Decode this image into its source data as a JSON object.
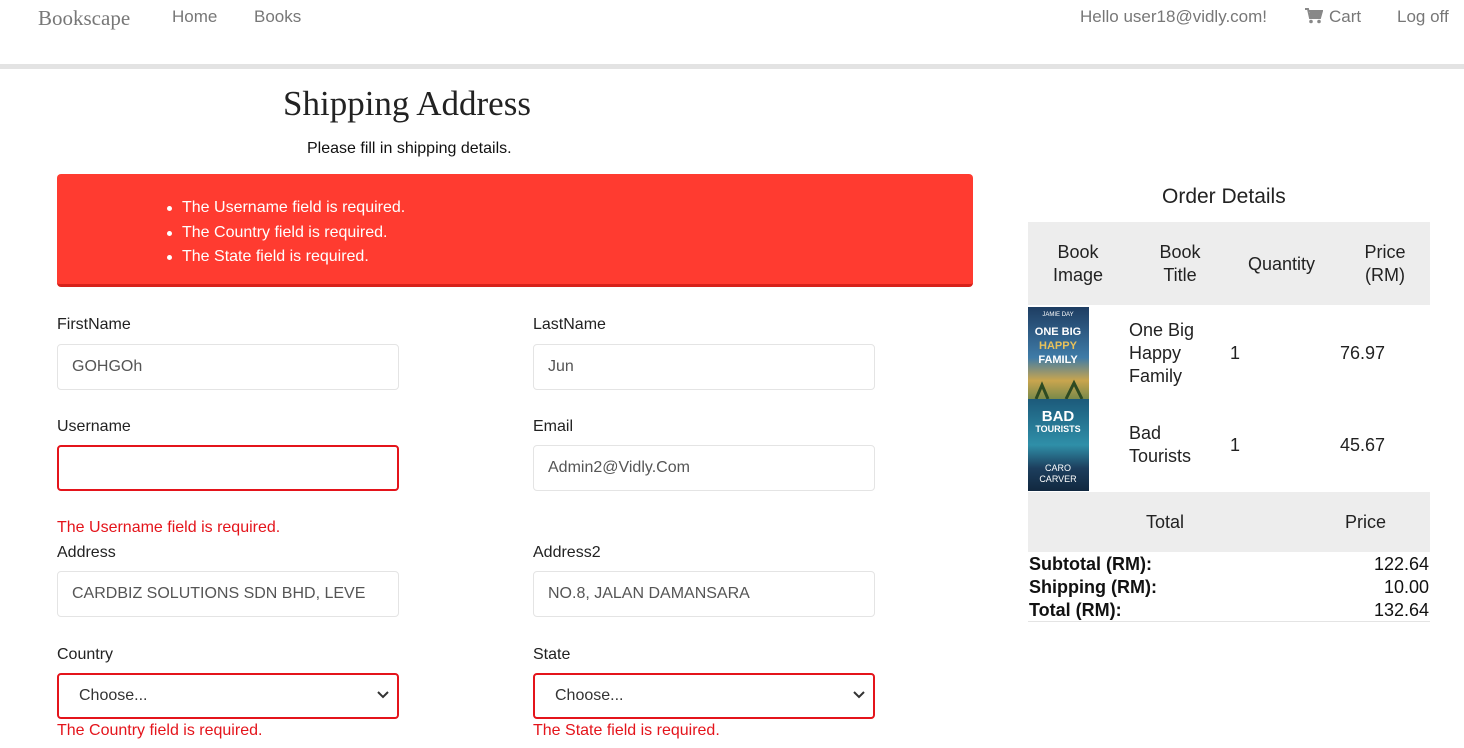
{
  "navbar": {
    "brand": "Bookscape",
    "links": [
      "Home",
      "Books"
    ],
    "greeting": "Hello user18@vidly.com!",
    "cart_label": "Cart",
    "logoff_label": "Log off"
  },
  "page": {
    "title": "Shipping Address",
    "subtitle": "Please fill in shipping details."
  },
  "validation_summary": [
    "The Username field is required.",
    "The Country field is required.",
    "The State field is required."
  ],
  "form": {
    "firstname": {
      "label": "FirstName",
      "value": "GOHGOh"
    },
    "lastname": {
      "label": "LastName",
      "value": "Jun"
    },
    "username": {
      "label": "Username",
      "value": "",
      "error": "The Username field is required."
    },
    "email": {
      "label": "Email",
      "value": "Admin2@Vidly.Com"
    },
    "address": {
      "label": "Address",
      "value": "CARDBIZ SOLUTIONS SDN BHD, LEVE"
    },
    "address2": {
      "label": "Address2",
      "value": "NO.8, JALAN DAMANSARA"
    },
    "country": {
      "label": "Country",
      "value": "Choose...",
      "error": "The Country field is required."
    },
    "state": {
      "label": "State",
      "value": "Choose...",
      "error": "The State field is required."
    }
  },
  "order": {
    "title": "Order Details",
    "headers": {
      "image_1": "Book",
      "image_2": "Image",
      "title_1": "Book",
      "title_2": "Title",
      "quantity": "Quantity",
      "price_1": "Price",
      "price_2": "(RM)"
    },
    "items": [
      {
        "cover_text_top": "JAMIE DAY",
        "cover_text": "ONE BIG HAPPY FAMILY",
        "title_lines": [
          "One Big",
          "Happy",
          "Family"
        ],
        "quantity": "1",
        "price": "76.97"
      },
      {
        "cover_text": "BAD TOURISTS",
        "cover_text_bottom": "CARO CARVER",
        "title_lines": [
          "Bad",
          "Tourists"
        ],
        "quantity": "1",
        "price": "45.67"
      }
    ],
    "total_header": "Total",
    "price_header": "Price",
    "summary": [
      {
        "label": "Subtotal (RM):",
        "value": "122.64"
      },
      {
        "label": "Shipping (RM):",
        "value": "10.00"
      },
      {
        "label": "Total (RM):",
        "value": "132.64"
      }
    ]
  },
  "colors": {
    "error": "#e4141b",
    "alert_bg": "#ff3b30",
    "table_header_bg": "#ededed"
  }
}
